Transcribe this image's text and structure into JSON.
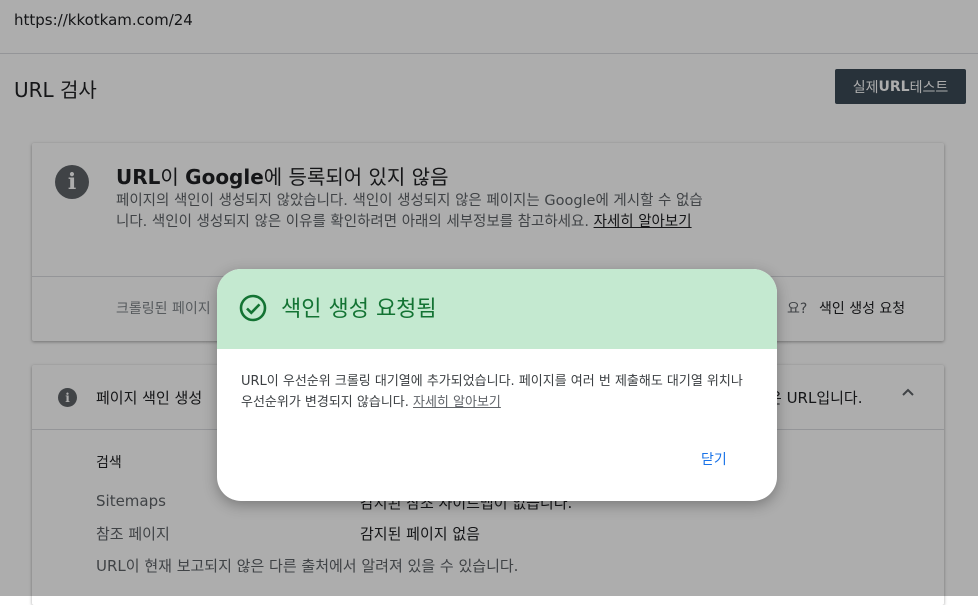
{
  "browser": {
    "url": "https://kkotkam.com/24"
  },
  "header": {
    "title": "URL 검사",
    "live_test_prefix": "실제 ",
    "live_test_bold": "URL",
    "live_test_suffix": " 테스트"
  },
  "status_card": {
    "title_url": "URL",
    "title_mid": "이 ",
    "title_google": "Google",
    "title_rest": "에 등록되어 있지 않음",
    "description": "페이지의 색인이 생성되지 않았습니다. 색인이 생성되지 않은 페이지는 Google에 게시할 수 없습니다. 색인이 생성되지 않은 이유를 확인하려면 아래의 세부정보를 참고하세요. ",
    "learn_more": "자세히 알아보기",
    "crawled_text": "크롤링된 페이지",
    "question_tail": "요?",
    "request_indexing": "색인 생성 요청"
  },
  "detail_card": {
    "header_left": "페이지 색인 생성",
    "header_right": "은 URL입니다.",
    "search_label": "검색",
    "rows": [
      {
        "label": "Sitemaps",
        "value": "감지된 참조 사이트맵이 없습니다."
      },
      {
        "label": "참조 페이지",
        "value": "감지된 페이지 없음"
      }
    ],
    "footnote": "URL이 현재 보고되지 않은 다른 출처에서 알려져 있을 수 있습니다."
  },
  "dialog": {
    "title": "색인 생성 요청됨",
    "body": "URL이 우선순위 크롤링 대기열에 추가되었습니다. 페이지를 여러 번 제출해도 대기열 위치나 우선순위가 변경되지 않습니다. ",
    "learn_more": "자세히 알아보기",
    "close_label": "닫기",
    "accent_color": "#137333",
    "header_color": "#c4e9d0"
  },
  "icons": {
    "info": "info-icon",
    "check": "check-circle-icon",
    "chevron": "chevron-up-icon"
  }
}
